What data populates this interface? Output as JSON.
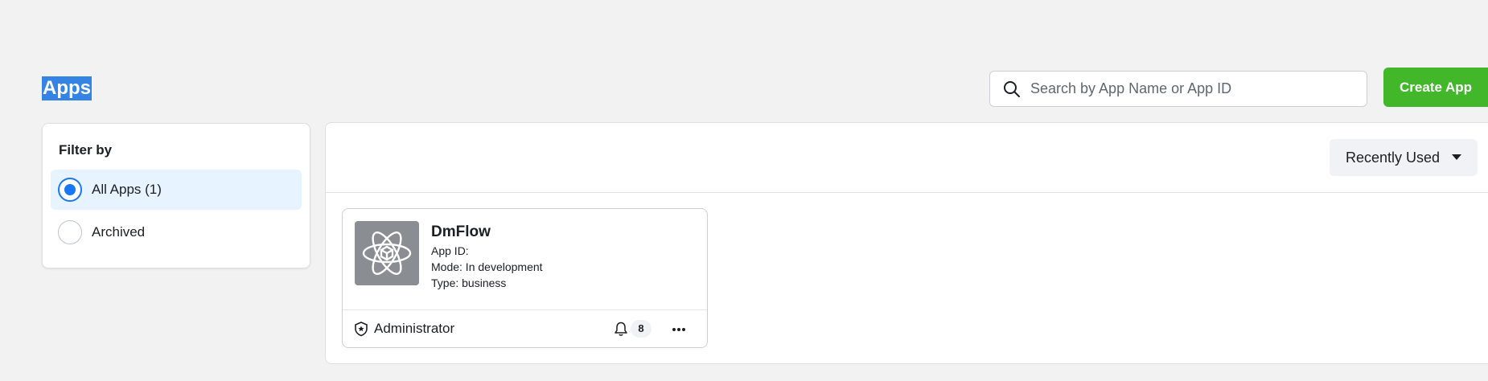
{
  "header": {
    "title": "Apps",
    "search_placeholder": "Search by App Name or App ID",
    "create_label": "Create App"
  },
  "filter": {
    "title": "Filter by",
    "options": [
      {
        "label": "All Apps (1)",
        "selected": true
      },
      {
        "label": "Archived",
        "selected": false
      }
    ]
  },
  "sort": {
    "label": "Recently Used"
  },
  "apps": [
    {
      "name": "DmFlow",
      "app_id_label": "App ID:",
      "mode": "Mode: In development",
      "type": "Type: business",
      "role": "Administrator",
      "notifications": "8",
      "icon": "atom-icon"
    }
  ],
  "colors": {
    "accent": "#1877f2",
    "create_button": "#42b72a",
    "selected_filter_bg": "#e7f3ff",
    "title_highlight": "#3584e4"
  }
}
